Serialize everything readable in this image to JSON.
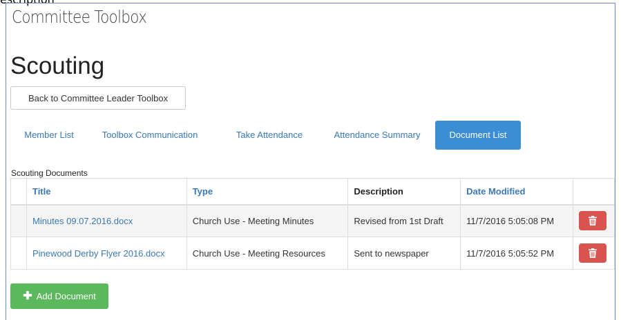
{
  "cutoff_label": "escription",
  "header": {
    "toolbox_title": "Committee Toolbox",
    "page_title": "Scouting",
    "back_button_label": "Back to Committee Leader Toolbox"
  },
  "tabs": [
    {
      "label": "Member List",
      "active": false
    },
    {
      "label": "Toolbox Communication",
      "active": false
    },
    {
      "label": "Take Attendance",
      "active": false
    },
    {
      "label": "Attendance Summary",
      "active": false
    },
    {
      "label": "Document List",
      "active": true
    }
  ],
  "documents": {
    "section_label": "Scouting Documents",
    "columns": [
      "Title",
      "Type",
      "Description",
      "Date Modified"
    ],
    "rows": [
      {
        "title": "Minutes 09.07.2016.docx",
        "type": "Church Use - Meeting Minutes",
        "description": "Revised from 1st Draft",
        "date_modified": "11/7/2016 5:05:08 PM"
      },
      {
        "title": "Pinewood Derby Flyer 2016.docx",
        "type": "Church Use - Meeting Resources",
        "description": "Sent to newspaper",
        "date_modified": "11/7/2016 5:05:52 PM"
      }
    ]
  },
  "add_button_label": "Add Document",
  "colors": {
    "primary": "#3b8ed4",
    "link": "#3a78b5",
    "danger": "#d9534f",
    "success": "#5cb85c"
  },
  "icons": {
    "delete": "trash-icon",
    "add": "plus-icon"
  }
}
